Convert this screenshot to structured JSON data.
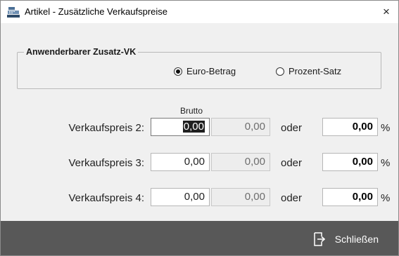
{
  "window": {
    "title": "Artikel - Zusätzliche Verkaufspreise",
    "close_glyph": "×"
  },
  "group": {
    "legend": "Anwenderbarer Zusatz-VK",
    "options": [
      {
        "label": "Euro-Betrag",
        "checked": true
      },
      {
        "label": "Prozent-Satz",
        "checked": false
      }
    ]
  },
  "columns": {
    "brutto_header": "Brutto"
  },
  "rows": [
    {
      "label": "Verkaufspreis 2:",
      "value": "0,00",
      "brutto": "0,00",
      "oder": "oder",
      "percent": "0,00",
      "percent_sign": "%"
    },
    {
      "label": "Verkaufspreis 3:",
      "value": "0,00",
      "brutto": "0,00",
      "oder": "oder",
      "percent": "0,00",
      "percent_sign": "%"
    },
    {
      "label": "Verkaufspreis 4:",
      "value": "0,00",
      "brutto": "0,00",
      "oder": "oder",
      "percent": "0,00",
      "percent_sign": "%"
    }
  ],
  "footer": {
    "close_label": "Schließen",
    "icon": "exit-icon"
  }
}
